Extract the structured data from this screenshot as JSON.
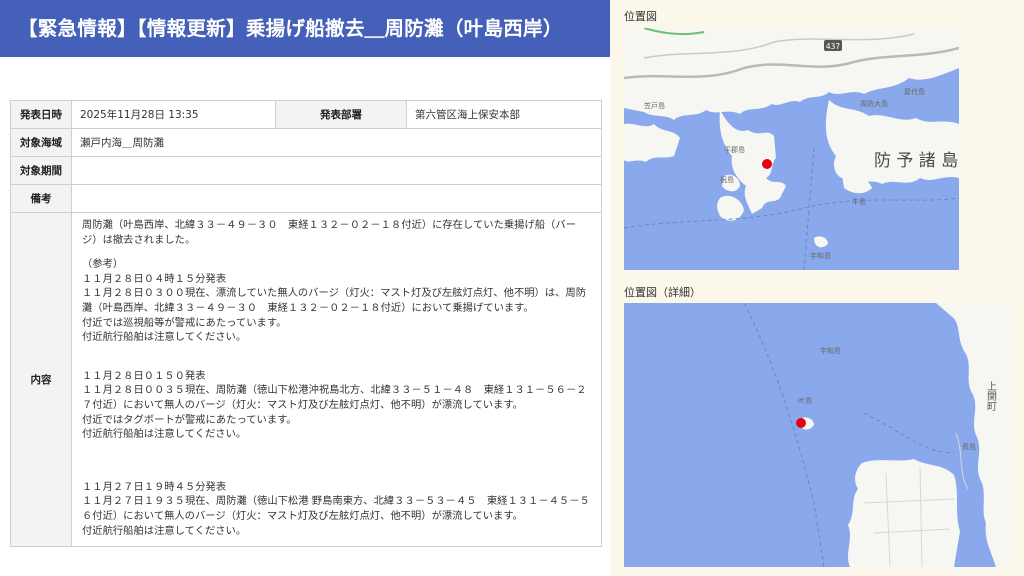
{
  "header": {
    "title": "【緊急情報】【情報更新】乗揚げ船撤去＿周防灘（叶島西岸）"
  },
  "table": {
    "date_label": "発表日時",
    "date_value": "2025年11月28日 13:35",
    "dept_label": "発表部署",
    "dept_value": "第六管区海上保安本部",
    "area_label": "対象海域",
    "area_value": "瀬戸内海＿周防灘",
    "period_label": "対象期間",
    "period_value": "",
    "remarks_label": "備考",
    "remarks_value": "",
    "content_label": "内容",
    "content": {
      "main": "周防灘（叶島西岸、北緯３３－４９－３０　東経１３２－０２－１８付近）に存在していた乗揚げ船（バージ）は撤去されました。",
      "ref": "（参考）",
      "u1_head": "１１月２８日０４時１５分発表",
      "u1_body": "１１月２８日０３００現在、漂流していた無人のバージ（灯火：マスト灯及び左舷灯点灯、他不明）は、周防灘（叶島西岸、北緯３３－４９－３０　東経１３２－０２－１８付近）において乗揚げています。",
      "u1_l3": "付近では巡視船等が警戒にあたっています。",
      "u1_l4": "付近航行船舶は注意してください。",
      "u2_head": "１１月２８日０１５０発表",
      "u2_body": "１１月２８日００３５現在、周防灘（徳山下松港沖祝島北方、北緯３３－５１－４８　東経１３１－５６－２７付近）において無人のバージ（灯火：マスト灯及び左舷灯点灯、他不明）が漂流しています。",
      "u2_l3": "付近ではタグボートが警戒にあたっています。",
      "u2_l4": "付近航行船舶は注意してください。",
      "u3_head": "１１月２７日１９時４５分発表",
      "u3_body": "１１月２７日１９３５現在、周防灘（徳山下松港 野島南東方、北緯３３－５３－４５　東経１３１－４５－５６付近）において無人のバージ（灯火：マスト灯及び左舷灯点灯、他不明）が漂流しています。",
      "u3_l4": "付近航行船舶は注意してください。"
    }
  },
  "map1": {
    "label": "位置図",
    "place_text": "防 予 諸 島",
    "small_labels": [
      "笠戸島",
      "平郡島",
      "祝島",
      "屋代島",
      "周防大島",
      "牛島",
      "宇和島"
    ],
    "route_badge": "437"
  },
  "map2": {
    "label": "位置図（詳細）",
    "labels": [
      "上関町",
      "叶島",
      "長島",
      "宇和島"
    ]
  },
  "colors": {
    "header_bg": "#4460b8",
    "sea": "#8aa9ec",
    "land": "#f6f6f2",
    "marker": "#e60012"
  }
}
